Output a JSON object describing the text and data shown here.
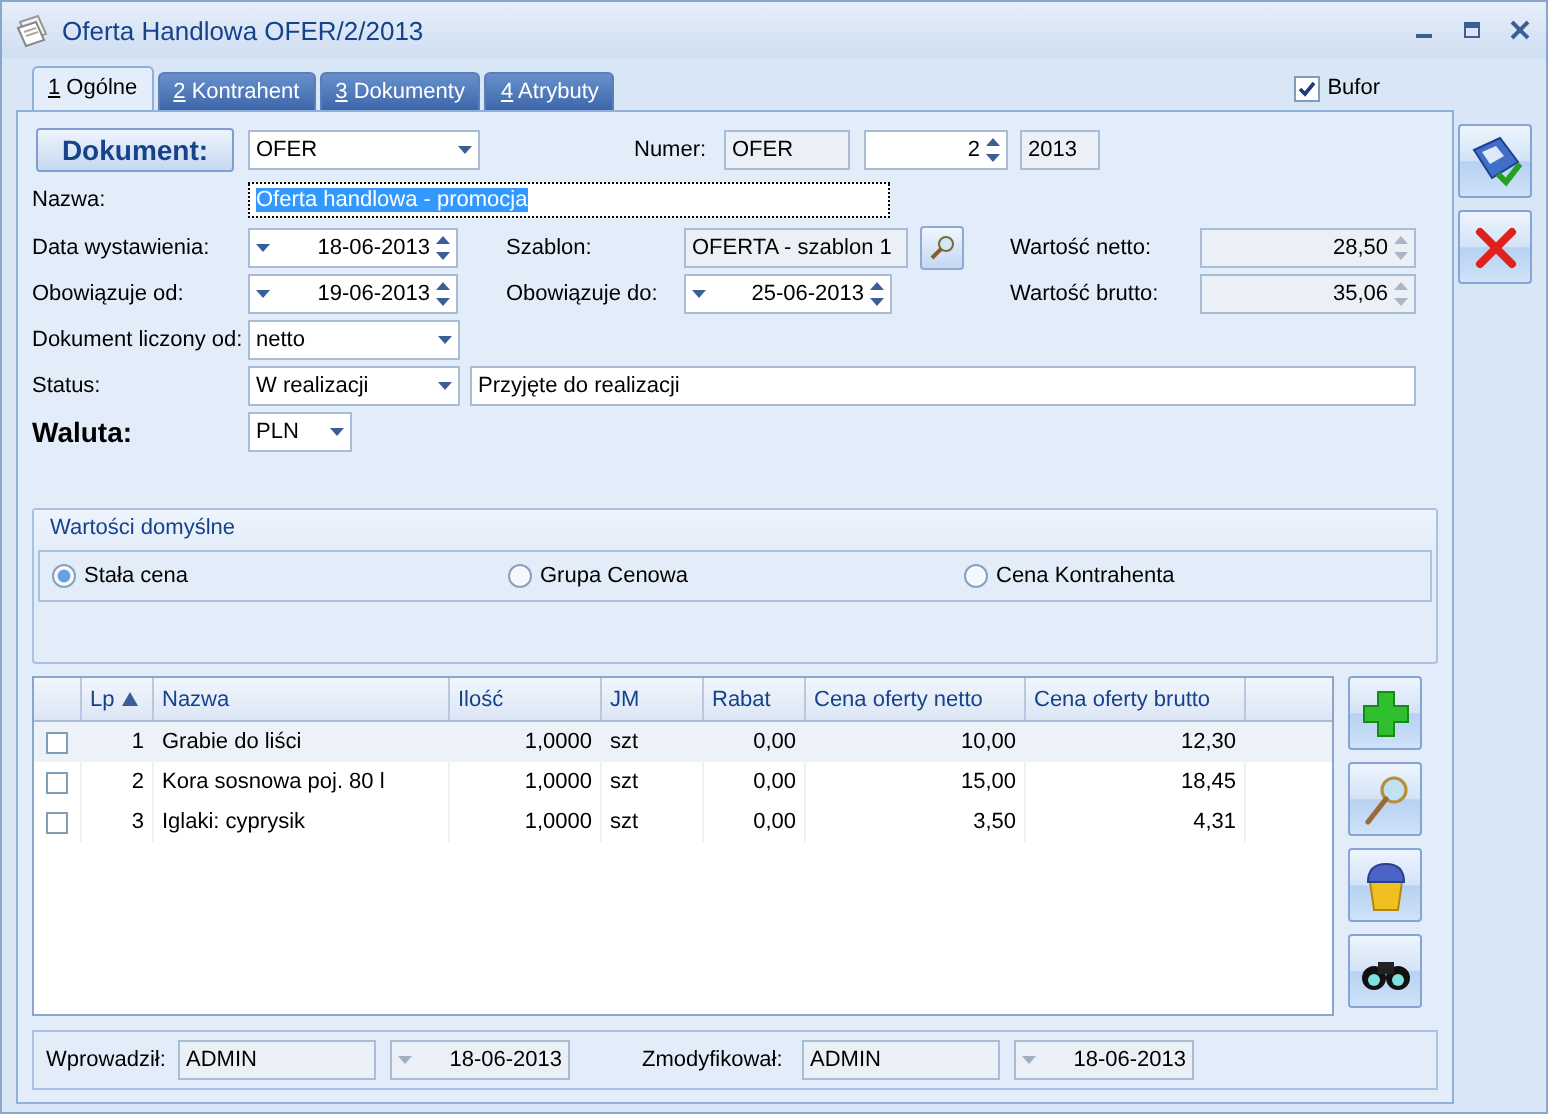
{
  "window": {
    "title": "Oferta Handlowa OFER/2/2013"
  },
  "tabs": [
    {
      "key": "1",
      "label": "Ogólne",
      "selected": true
    },
    {
      "key": "2",
      "label": "Kontrahent",
      "selected": false
    },
    {
      "key": "3",
      "label": "Dokumenty",
      "selected": false
    },
    {
      "key": "4",
      "label": "Atrybuty",
      "selected": false
    }
  ],
  "bufor": {
    "label": "Bufor",
    "checked": true
  },
  "document": {
    "button": "Dokument:",
    "type": "OFER",
    "number_label": "Numer:",
    "number_prefix": "OFER",
    "number": "2",
    "year": "2013"
  },
  "name": {
    "label": "Nazwa:",
    "value": "Oferta handlowa - promocja",
    "text_selected": true
  },
  "issue_date": {
    "label": "Data wystawienia:",
    "value": "18-06-2013"
  },
  "valid_from": {
    "label": "Obowiązuje od:",
    "value": "19-06-2013"
  },
  "template": {
    "label": "Szablon:",
    "value": "OFERTA - szablon 1"
  },
  "valid_to": {
    "label": "Obowiązuje do:",
    "value": "25-06-2013"
  },
  "net_value": {
    "label": "Wartość netto:",
    "value": "28,50"
  },
  "gross_value": {
    "label": "Wartość brutto:",
    "value": "35,06"
  },
  "calculated_from": {
    "label": "Dokument liczony od:",
    "value": "netto"
  },
  "status": {
    "label": "Status:",
    "value": "W realizacji",
    "description": "Przyjęte do realizacji"
  },
  "currency": {
    "label": "Waluta:",
    "value": "PLN"
  },
  "defaults": {
    "title": "Wartości domyślne",
    "options": [
      {
        "label": "Stała cena",
        "selected": true
      },
      {
        "label": "Grupa Cenowa",
        "selected": false
      },
      {
        "label": "Cena Kontrahenta",
        "selected": false
      }
    ]
  },
  "table": {
    "columns": [
      {
        "label": "Lp",
        "sorted": true
      },
      {
        "label": "Nazwa",
        "sorted": false
      },
      {
        "label": "Ilość",
        "sorted": false
      },
      {
        "label": "JM",
        "sorted": false
      },
      {
        "label": "Rabat",
        "sorted": false
      },
      {
        "label": "Cena oferty netto",
        "sorted": false
      },
      {
        "label": "Cena oferty brutto",
        "sorted": false
      }
    ],
    "rows": [
      {
        "selected": true,
        "checked": false,
        "cells": [
          "1",
          "Grabie do liści",
          "1,0000",
          "szt",
          "0,00",
          "10,00",
          "12,30"
        ]
      },
      {
        "selected": false,
        "checked": false,
        "cells": [
          "2",
          "Kora sosnowa poj. 80 l",
          "1,0000",
          "szt",
          "0,00",
          "15,00",
          "18,45"
        ]
      },
      {
        "selected": false,
        "checked": false,
        "cells": [
          "3",
          "Iglaki: cyprysik",
          "1,0000",
          "szt",
          "0,00",
          "3,50",
          "4,31"
        ]
      }
    ]
  },
  "footer": {
    "entered_label": "Wprowadził:",
    "entered_by": "ADMIN",
    "entered_date": "18-06-2013",
    "modified_label": "Zmodyfikował:",
    "modified_by": "ADMIN",
    "modified_date": "18-06-2013"
  }
}
